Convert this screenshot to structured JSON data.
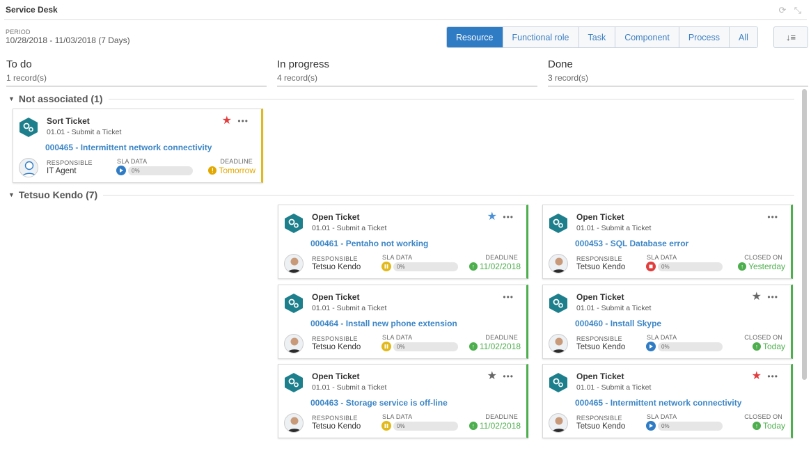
{
  "panel": {
    "title": "Service Desk"
  },
  "period": {
    "label": "PERIOD",
    "value": "10/28/2018 - 11/03/2018 (7 Days)"
  },
  "tabs": [
    {
      "label": "Resource",
      "active": true
    },
    {
      "label": "Functional role",
      "active": false
    },
    {
      "label": "Task",
      "active": false
    },
    {
      "label": "Component",
      "active": false
    },
    {
      "label": "Process",
      "active": false
    },
    {
      "label": "All",
      "active": false
    }
  ],
  "sort_icon": "sort-az-icon",
  "columns": [
    {
      "title": "To do",
      "count": "1 record(s)"
    },
    {
      "title": "In progress",
      "count": "4 record(s)"
    },
    {
      "title": "Done",
      "count": "3 record(s)"
    }
  ],
  "groups": [
    {
      "title": "Not associated (1)"
    },
    {
      "title": "Tetsuo Kendo (7)"
    }
  ],
  "colors": {
    "accent": "#2f7cc5",
    "link": "#3c86c6",
    "teal": "#1d7f8c",
    "green": "#4cae4c",
    "yellow": "#e2b91a",
    "red": "#e23d3d",
    "blue_star": "#4a90d9",
    "gray_star": "#666666"
  },
  "cards": [
    {
      "title": "Sort Ticket",
      "subtitle": "01.01 - Submit a Ticket",
      "link": "000465 - Intermittent network connectivity",
      "star": "red",
      "resp_label": "RESPONSIBLE",
      "resp_value": "IT Agent",
      "sla_label": "SLA DATA",
      "sla_icon": "play",
      "sla_value": "0%",
      "sla_fraction": 0,
      "date_label": "DEADLINE",
      "date_value": "Tomorrow",
      "date_icon": "warning",
      "date_color": "#e2a800",
      "border": "yellow",
      "avatar": "agent"
    },
    {
      "title": "Open Ticket",
      "subtitle": "01.01 - Submit a Ticket",
      "link": "000461 - Pentaho not working",
      "star": "blue",
      "resp_label": "RESPONSIBLE",
      "resp_value": "Tetsuo Kendo",
      "sla_label": "SLA DATA",
      "sla_icon": "pause",
      "sla_value": "0%",
      "sla_fraction": 0,
      "date_label": "DEADLINE",
      "date_value": "11/02/2018",
      "date_icon": "up",
      "date_color": "#4cae4c",
      "border": "green",
      "avatar": "person"
    },
    {
      "title": "Open Ticket",
      "subtitle": "01.01 - Submit a Ticket",
      "link": "000453 - SQL Database error",
      "star": "none",
      "resp_label": "RESPONSIBLE",
      "resp_value": "Tetsuo Kendo",
      "sla_label": "SLA DATA",
      "sla_icon": "stop",
      "sla_value": "0%",
      "sla_fraction": 0,
      "date_label": "CLOSED ON",
      "date_value": "Yesterday",
      "date_icon": "up",
      "date_color": "#4cae4c",
      "border": "green",
      "avatar": "person"
    },
    {
      "title": "Open Ticket",
      "subtitle": "01.01 - Submit a Ticket",
      "link": "000464 - Install new phone extension",
      "star": "none",
      "resp_label": "RESPONSIBLE",
      "resp_value": "Tetsuo Kendo",
      "sla_label": "SLA DATA",
      "sla_icon": "pause",
      "sla_value": "0%",
      "sla_fraction": 0,
      "date_label": "DEADLINE",
      "date_value": "11/02/2018",
      "date_icon": "up",
      "date_color": "#4cae4c",
      "border": "green",
      "avatar": "person"
    },
    {
      "title": "Open Ticket",
      "subtitle": "01.01 - Submit a Ticket",
      "link": "000460 - Install Skype",
      "star": "gray",
      "resp_label": "RESPONSIBLE",
      "resp_value": "Tetsuo Kendo",
      "sla_label": "SLA DATA",
      "sla_icon": "play",
      "sla_value": "0%",
      "sla_fraction": 0,
      "date_label": "CLOSED ON",
      "date_value": "Today",
      "date_icon": "up",
      "date_color": "#4cae4c",
      "border": "green",
      "avatar": "person"
    },
    {
      "title": "Open Ticket",
      "subtitle": "01.01 - Submit a Ticket",
      "link": "000463 - Storage service is off-line",
      "star": "gray",
      "resp_label": "RESPONSIBLE",
      "resp_value": "Tetsuo Kendo",
      "sla_label": "SLA DATA",
      "sla_icon": "pause",
      "sla_value": "0%",
      "sla_fraction": 0,
      "date_label": "DEADLINE",
      "date_value": "11/02/2018",
      "date_icon": "up",
      "date_color": "#4cae4c",
      "border": "green",
      "avatar": "person"
    },
    {
      "title": "Open Ticket",
      "subtitle": "01.01 - Submit a Ticket",
      "link": "000465 - Intermittent network connectivity",
      "star": "red",
      "resp_label": "RESPONSIBLE",
      "resp_value": "Tetsuo Kendo",
      "sla_label": "SLA DATA",
      "sla_icon": "play",
      "sla_value": "0%",
      "sla_fraction": 0,
      "date_label": "CLOSED ON",
      "date_value": "Today",
      "date_icon": "up",
      "date_color": "#4cae4c",
      "border": "green",
      "avatar": "person"
    }
  ]
}
